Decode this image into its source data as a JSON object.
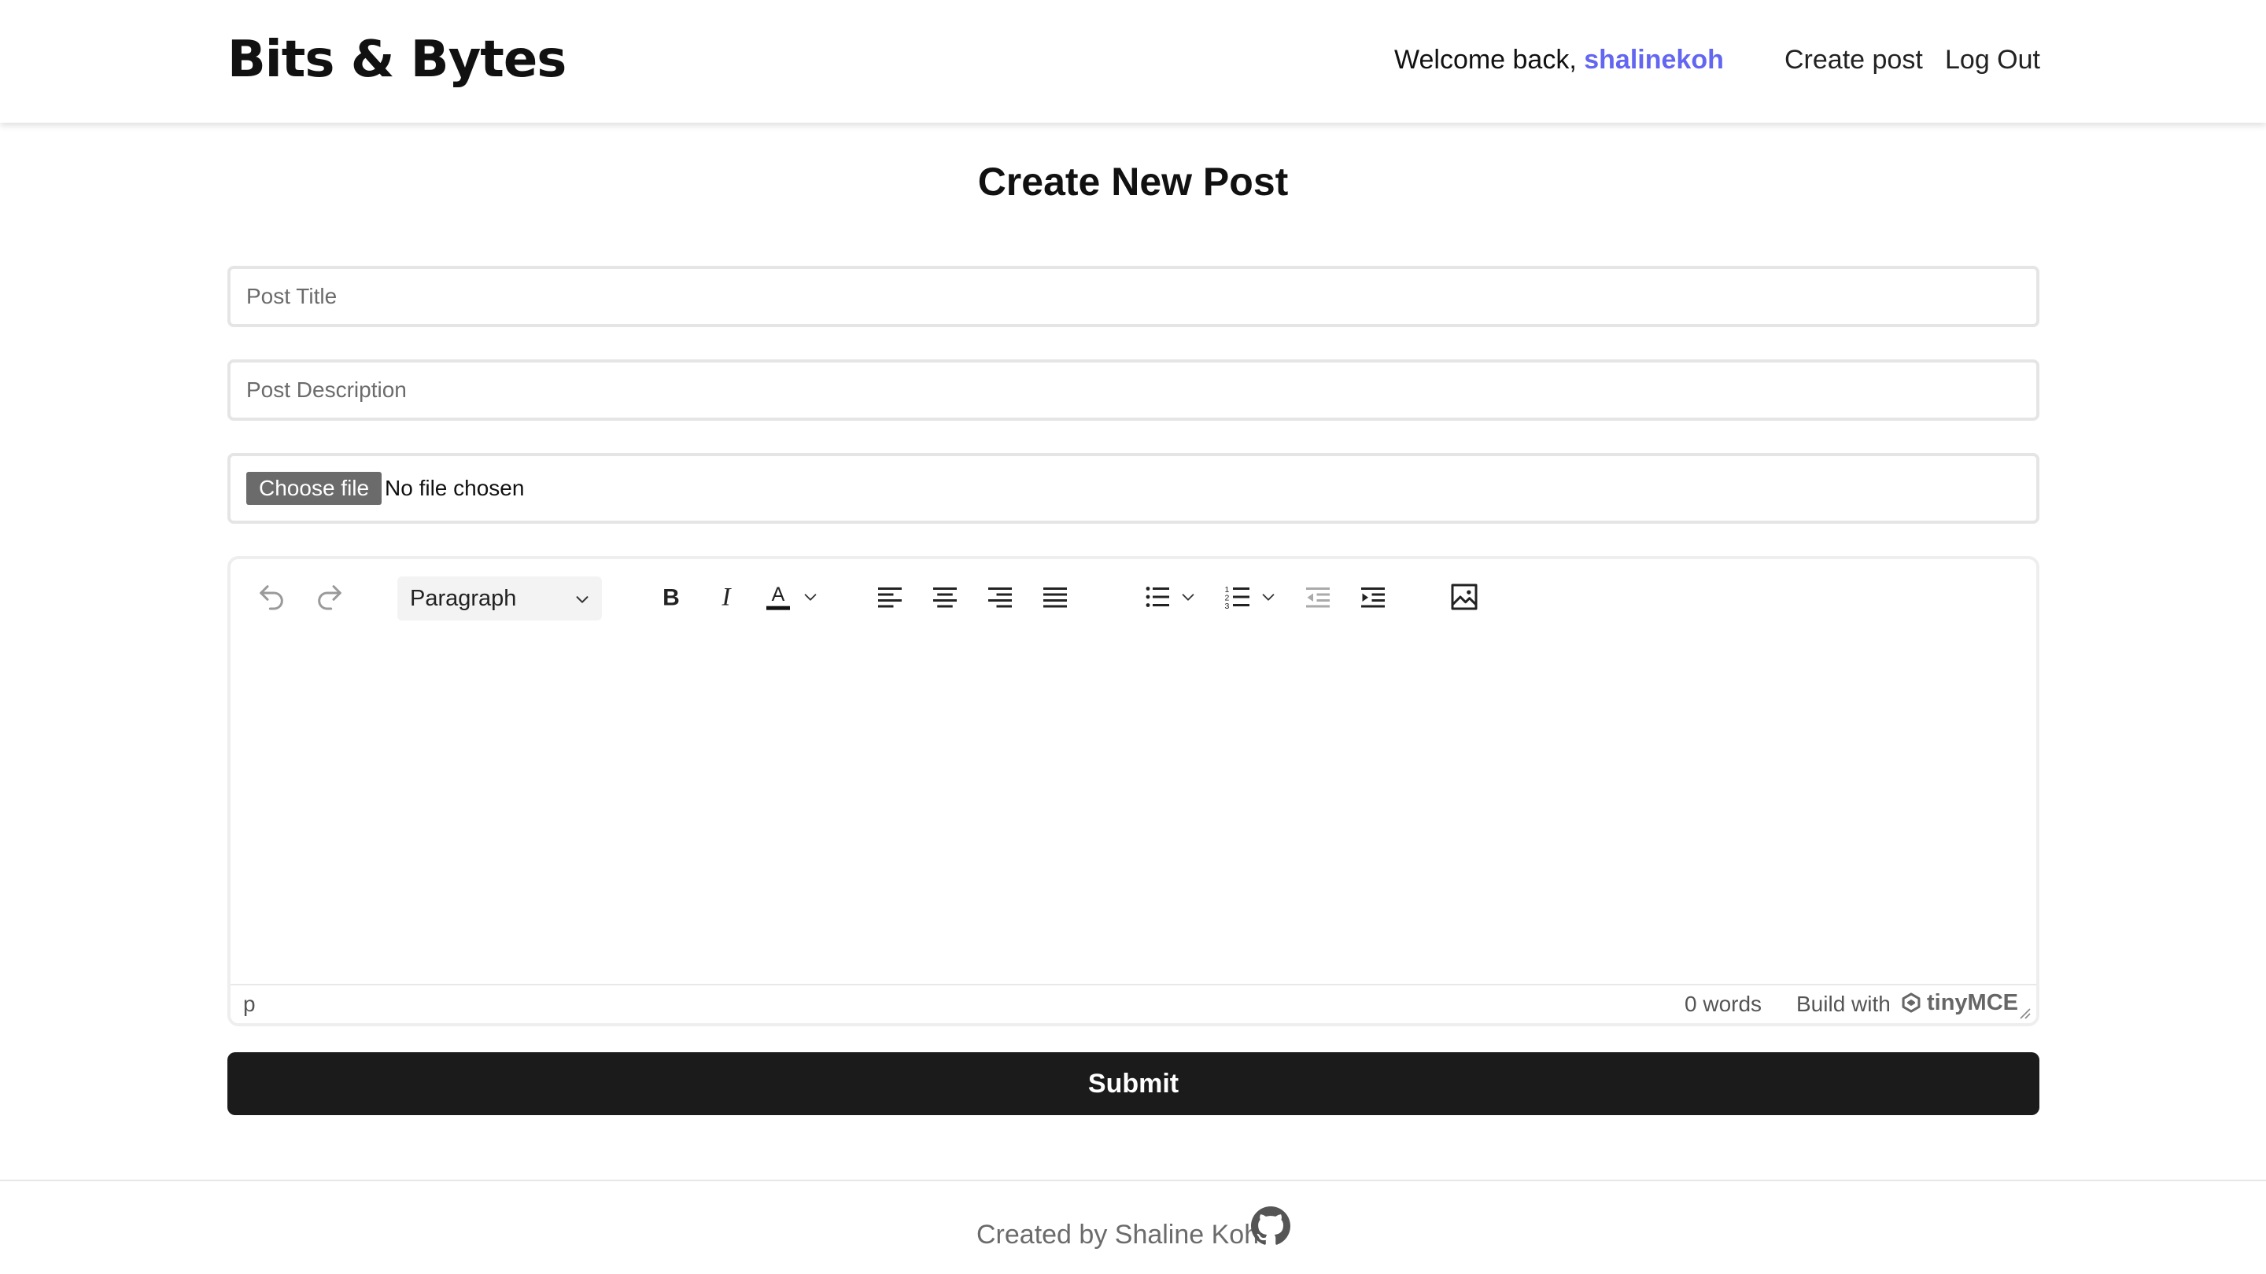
{
  "header": {
    "logo": "Bits & Bytes",
    "welcome_prefix": "Welcome back, ",
    "username": "shalinekoh",
    "nav": {
      "create_post": "Create post",
      "log_out": "Log Out"
    }
  },
  "main": {
    "title": "Create New Post",
    "post_title_placeholder": "Post Title",
    "post_description_placeholder": "Post Description",
    "file": {
      "button_label": "Choose file",
      "status": "No file chosen"
    },
    "editor": {
      "block_format": "Paragraph",
      "toolbar_icons": [
        "undo-icon",
        "redo-icon",
        "bold-icon",
        "italic-icon",
        "text-color-icon",
        "align-left-icon",
        "align-center-icon",
        "align-right-icon",
        "align-justify-icon",
        "bullet-list-icon",
        "numbered-list-icon",
        "outdent-icon",
        "indent-icon",
        "image-icon"
      ],
      "status_path": "p",
      "word_count": "0 words",
      "build_with": "Build with",
      "brand": "tinyMCE"
    },
    "submit_label": "Submit"
  },
  "footer": {
    "text": "Created by Shaline Koh",
    "icon": "github-icon"
  },
  "colors": {
    "accent": "#6366f1",
    "submit_bg": "#1b1b1b",
    "file_button_bg": "#6b6b6b"
  }
}
